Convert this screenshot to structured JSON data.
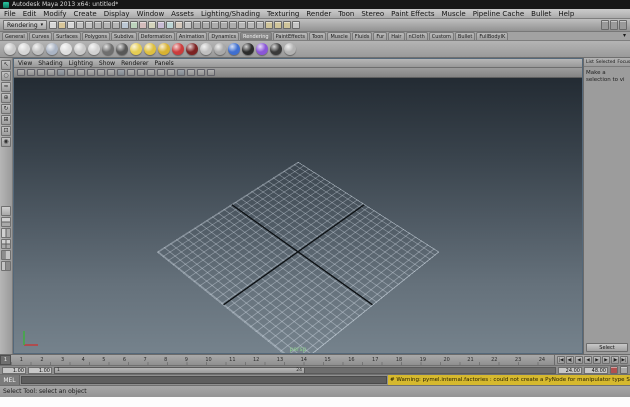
{
  "window": {
    "title": "Autodesk Maya 2013 x64: untitled*"
  },
  "colors": {
    "viewport_gradient_top": "#232b33",
    "viewport_gradient_bottom": "#75828c",
    "warning_background": "#d6b92e",
    "maya_logo_green": "#19a188"
  },
  "menu_bar": [
    "File",
    "Edit",
    "Modify",
    "Create",
    "Display",
    "Window",
    "Assets",
    "Lighting/Shading",
    "Texturing",
    "Render",
    "Toon",
    "Stereo",
    "Paint Effects",
    "Muscle",
    "Pipeline Cache",
    "Bullet",
    "Help"
  ],
  "status_line": {
    "menu_set": "Rendering",
    "icons": [
      {
        "name": "scene-new-icon",
        "color": "#d8d8d8"
      },
      {
        "name": "scene-open-icon",
        "color": "#d9c79a"
      },
      {
        "name": "scene-save-icon",
        "color": "#d8d8d8"
      },
      {
        "name": "undo-icon",
        "color": "#c2c2c2"
      },
      {
        "name": "redo-icon",
        "color": "#c2c2c2"
      },
      {
        "name": "select-hierarchy-icon",
        "color": "#b5b5b5"
      },
      {
        "name": "select-object-icon",
        "color": "#b5b5b5"
      },
      {
        "name": "select-component-icon",
        "color": "#b5b5b5"
      },
      {
        "name": "mask-handles-icon",
        "color": "#bcc8d4"
      },
      {
        "name": "mask-joints-icon",
        "color": "#bcd4bc"
      },
      {
        "name": "mask-curves-icon",
        "color": "#d4bcbc"
      },
      {
        "name": "mask-surfaces-icon",
        "color": "#d4d4bc"
      },
      {
        "name": "mask-deformations-icon",
        "color": "#c8bcd4"
      },
      {
        "name": "mask-dynamics-icon",
        "color": "#bcd4d4"
      },
      {
        "name": "mask-rendering-icon",
        "color": "#d4c8bc"
      },
      {
        "name": "mask-misc-icon",
        "color": "#c4c4c4"
      },
      {
        "name": "snap-grid-icon",
        "color": "#adadad"
      },
      {
        "name": "snap-curve-icon",
        "color": "#adadad"
      },
      {
        "name": "snap-point-icon",
        "color": "#adadad"
      },
      {
        "name": "snap-view-plane-icon",
        "color": "#adadad"
      },
      {
        "name": "make-live-icon",
        "color": "#adadad"
      },
      {
        "name": "input-connections-icon",
        "color": "#b8b8b8"
      },
      {
        "name": "output-connections-icon",
        "color": "#b8b8b8"
      },
      {
        "name": "construction-history-icon",
        "color": "#b8b8b8"
      },
      {
        "name": "open-render-view-icon",
        "color": "#cfc49a"
      },
      {
        "name": "render-current-frame-icon",
        "color": "#cfc49a"
      },
      {
        "name": "ipr-render-icon",
        "color": "#cfc49a"
      },
      {
        "name": "render-settings-icon",
        "color": "#c6c6c6"
      }
    ],
    "sidebar_toggles": [
      {
        "name": "toggle-attribute-editor-button",
        "color": "#9a9a9a"
      },
      {
        "name": "toggle-tool-settings-button",
        "color": "#9a9a9a"
      },
      {
        "name": "toggle-channel-box-button",
        "color": "#9a9a9a"
      }
    ]
  },
  "shelf": {
    "tabs": [
      {
        "label": "General"
      },
      {
        "label": "Curves"
      },
      {
        "label": "Surfaces"
      },
      {
        "label": "Polygons"
      },
      {
        "label": "Subdivs"
      },
      {
        "label": "Deformation"
      },
      {
        "label": "Animation"
      },
      {
        "label": "Dynamics"
      },
      {
        "label": "Rendering",
        "selected": true
      },
      {
        "label": "PaintEffects"
      },
      {
        "label": "Toon"
      },
      {
        "label": "Muscle"
      },
      {
        "label": "Fluids"
      },
      {
        "label": "Fur"
      },
      {
        "label": "Hair"
      },
      {
        "label": "nCloth"
      },
      {
        "label": "Custom"
      },
      {
        "label": "Bullet"
      },
      {
        "label": "FullBodyIK"
      }
    ],
    "menu_arrow": "▾",
    "items": [
      {
        "name": "shelf-anisotropic",
        "color": "#c9c9c9"
      },
      {
        "name": "shelf-blinn",
        "color": "#d6d6d6"
      },
      {
        "name": "shelf-lambert",
        "color": "#c0c0c0"
      },
      {
        "name": "shelf-ocean-shader",
        "color": "#aab4c4"
      },
      {
        "name": "shelf-phong",
        "color": "#dedede"
      },
      {
        "name": "shelf-phong-e",
        "color": "#cacaca"
      },
      {
        "name": "shelf-ramp-shader",
        "color": "#d2d2d2"
      },
      {
        "name": "shelf-surface-shader",
        "color": "#6f6f6f"
      },
      {
        "name": "shelf-use-background",
        "color": "#585858"
      },
      {
        "name": "shelf-ambient-light",
        "color": "#e5cd54"
      },
      {
        "name": "shelf-area-light",
        "color": "#dfc040"
      },
      {
        "name": "shelf-directional-light",
        "color": "#d8b232"
      },
      {
        "name": "shelf-point-light",
        "color": "#cc3c3c"
      },
      {
        "name": "shelf-spot-light",
        "color": "#7c2323"
      },
      {
        "name": "shelf-volume-light",
        "color": "#bfbfbf"
      },
      {
        "name": "shelf-camera",
        "color": "#a9a9a9"
      },
      {
        "name": "shelf-checker-texture",
        "color": "#3f6fd0"
      },
      {
        "name": "shelf-ramp-texture",
        "color": "#2c2c2c"
      },
      {
        "name": "shelf-fluid-texture",
        "color": "#8a56d7"
      },
      {
        "name": "shelf-render-view",
        "color": "#3a3a3a"
      },
      {
        "name": "shelf-ipr",
        "color": "#b2b2b2"
      }
    ]
  },
  "toolbox": {
    "tools": [
      {
        "name": "select-tool-icon",
        "glyph": "↖"
      },
      {
        "name": "lasso-tool-icon",
        "glyph": "○"
      },
      {
        "name": "paint-select-tool-icon",
        "glyph": "≈"
      },
      {
        "name": "move-tool-icon",
        "glyph": "⊕"
      },
      {
        "name": "rotate-tool-icon",
        "glyph": "↻"
      },
      {
        "name": "scale-tool-icon",
        "glyph": "⊞"
      },
      {
        "name": "universal-manipulator-icon",
        "glyph": "⊡"
      },
      {
        "name": "soft-modification-icon",
        "glyph": "◉"
      }
    ],
    "layouts": [
      {
        "name": "layout-single-pane-icon"
      },
      {
        "name": "layout-two-pane-stacked-icon"
      },
      {
        "name": "layout-two-pane-side-icon"
      },
      {
        "name": "layout-four-pane-icon"
      },
      {
        "name": "layout-outliner-persp-icon"
      },
      {
        "name": "layout-persp-graph-icon"
      }
    ]
  },
  "viewport": {
    "menus": [
      "View",
      "Shading",
      "Lighting",
      "Show",
      "Renderer",
      "Panels"
    ],
    "toolbar_icons": [
      {
        "name": "select-camera-icon"
      },
      {
        "name": "lock-camera-icon"
      },
      {
        "name": "camera-attributes-icon"
      },
      {
        "name": "bookmarks-icon"
      },
      {
        "name": "image-plane-icon"
      },
      {
        "name": "wireframe-icon"
      },
      {
        "name": "smooth-shade-icon"
      },
      {
        "name": "textured-icon"
      },
      {
        "name": "use-all-lights-icon"
      },
      {
        "name": "shadows-icon"
      },
      {
        "name": "screen-space-ao-icon"
      },
      {
        "name": "motion-blur-icon"
      },
      {
        "name": "multisampling-icon"
      },
      {
        "name": "isolate-select-icon"
      },
      {
        "name": "field-chart-icon"
      },
      {
        "name": "resolution-gate-icon"
      },
      {
        "name": "film-gate-icon"
      },
      {
        "name": "gate-mask-icon"
      },
      {
        "name": "safe-display-icon"
      },
      {
        "name": "heads-up-display-icon"
      }
    ],
    "camera_label": "persp"
  },
  "attribute_panel": {
    "menus": [
      "List",
      "Selected",
      "Focus"
    ],
    "message": "Make a selection to vi",
    "select_button": "Select"
  },
  "time_slider": {
    "current_frame": "1",
    "frames": [
      1,
      2,
      3,
      4,
      5,
      6,
      7,
      8,
      9,
      10,
      11,
      12,
      13,
      14,
      15,
      16,
      17,
      18,
      19,
      20,
      21,
      22,
      23,
      24
    ],
    "playback_controls": [
      {
        "name": "go-to-start-button",
        "glyph": "|◀"
      },
      {
        "name": "step-back-key-button",
        "glyph": "◀|"
      },
      {
        "name": "step-back-frame-button",
        "glyph": "◀"
      },
      {
        "name": "play-backwards-button",
        "glyph": "◀"
      },
      {
        "name": "play-forwards-button",
        "glyph": "▶"
      },
      {
        "name": "step-forward-frame-button",
        "glyph": "▶"
      },
      {
        "name": "step-forward-key-button",
        "glyph": "|▶"
      },
      {
        "name": "go-to-end-button",
        "glyph": "▶|"
      }
    ]
  },
  "range_slider": {
    "anim_start": "1.00",
    "play_start": "1.00",
    "bar_start_label": "1",
    "bar_end_label": "24",
    "play_end": "24.00",
    "anim_end": "48.00"
  },
  "command_line": {
    "label": "MEL",
    "input_value": "",
    "warning": "# Warning: pymel.internal.factories : could not create a PyNode for manipulator type ShelfLocatorManip"
  },
  "help_line": {
    "text": "Select Tool: select an object"
  }
}
